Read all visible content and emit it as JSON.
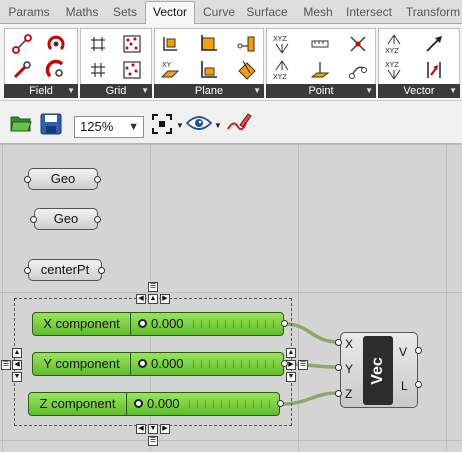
{
  "tabs": [
    "Params",
    "Maths",
    "Sets",
    "Vector",
    "Curve",
    "Surface",
    "Mesh",
    "Intersect",
    "Transform"
  ],
  "active_tab": "Vector",
  "ribbon": {
    "panels": [
      {
        "label": "Field",
        "icons": [
          "field-line-icon",
          "field-spin-icon",
          "field-point-icon",
          "field-charge-icon"
        ]
      },
      {
        "label": "Grid",
        "icons": [
          "grid-square-icon",
          "grid-populate-icon",
          "grid-rect-icon",
          "grid-random-icon"
        ]
      },
      {
        "label": "Plane",
        "icons": [
          "plane-axes-icon",
          "plane-origin-icon",
          "plane-xy-icon",
          "plane-line-icon",
          "plane-align-icon",
          "plane-rotate-icon"
        ]
      },
      {
        "label": "Point",
        "icons": [
          "point-decompose-icon",
          "point-distance-icon",
          "point-network-icon",
          "point-construct-icon",
          "point-project-icon",
          "point-cull-icon"
        ]
      },
      {
        "label": "Vector",
        "icons": [
          "vector-xyz-icon",
          "vector-amplitude-icon",
          "vector-deconstruct-icon",
          "vector-reverse-icon"
        ]
      }
    ]
  },
  "toolbar": {
    "zoom": "125%"
  },
  "canvas": {
    "params": [
      {
        "label": "Geo"
      },
      {
        "label": "Geo"
      },
      {
        "label": "centerPt"
      }
    ],
    "sliders": [
      {
        "name": "X component",
        "value": "0.000"
      },
      {
        "name": "Y component",
        "value": "0.000"
      },
      {
        "name": "Z component",
        "value": "0.000"
      }
    ],
    "vector_node": {
      "title": "Vec",
      "inputs": [
        "X",
        "Y",
        "Z"
      ],
      "outputs": [
        "V",
        "L"
      ]
    }
  },
  "colors": {
    "slider_green": "#6fcf35",
    "wire": "#7fa05a"
  }
}
